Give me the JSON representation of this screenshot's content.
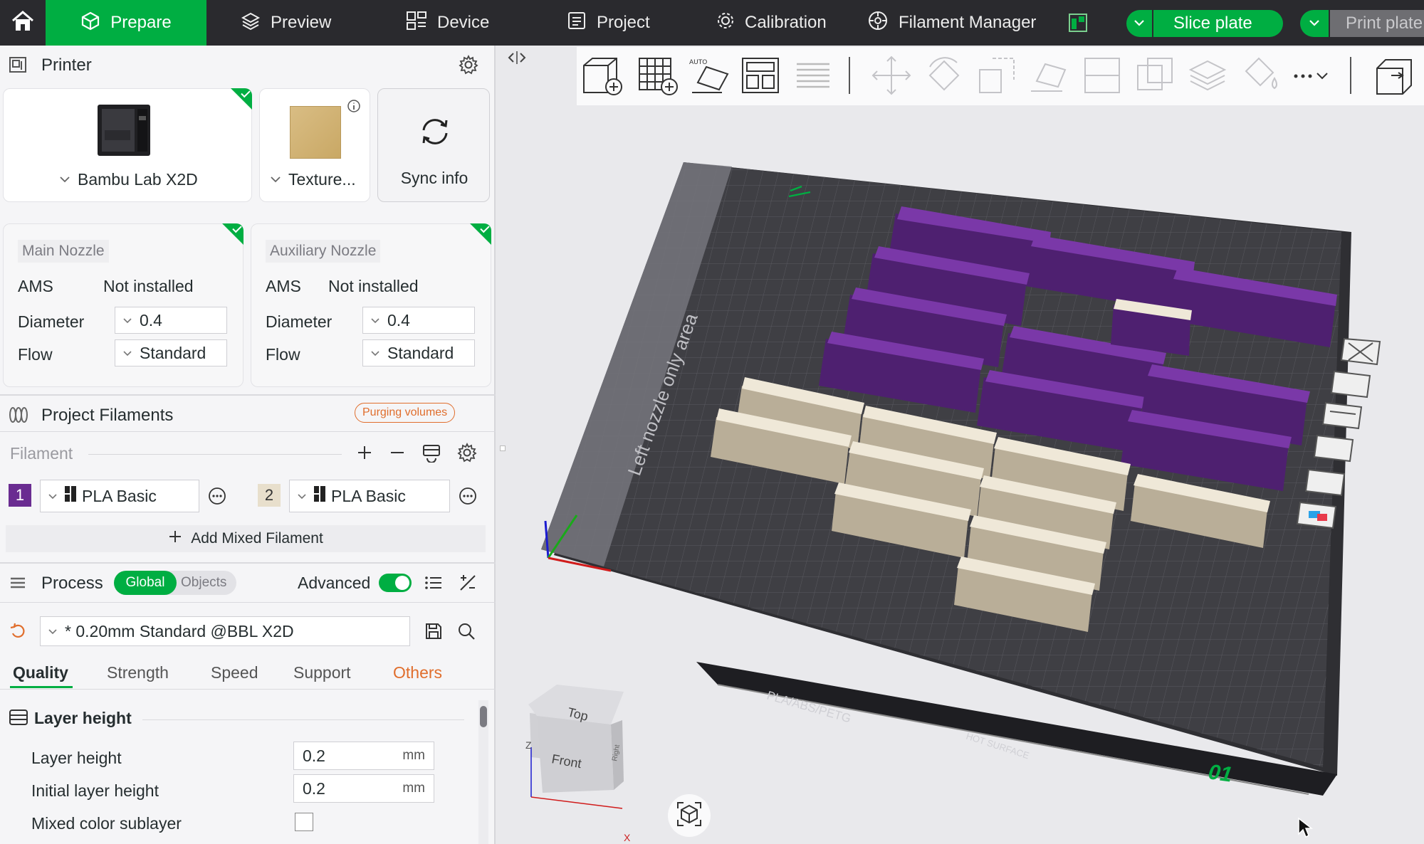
{
  "topbar": {
    "tabs": [
      {
        "label": "Prepare",
        "icon": "cube-icon"
      },
      {
        "label": "Preview",
        "icon": "layers-icon"
      },
      {
        "label": "Device",
        "icon": "device-icon"
      },
      {
        "label": "Project",
        "icon": "project-icon"
      },
      {
        "label": "Calibration",
        "icon": "calibration-icon"
      },
      {
        "label": "Filament Manager",
        "icon": "filament-manager-icon"
      }
    ],
    "slice_label": "Slice plate",
    "print_label": "Print plate"
  },
  "printer": {
    "title": "Printer",
    "model": "Bambu Lab X2D",
    "plate": "Texture...",
    "sync_label": "Sync info"
  },
  "main_nozzle": {
    "title": "Main Nozzle",
    "ams_label": "AMS",
    "ams_value": "Not installed",
    "diameter_label": "Diameter",
    "diameter_value": "0.4",
    "flow_label": "Flow",
    "flow_value": "Standard"
  },
  "aux_nozzle": {
    "title": "Auxiliary Nozzle",
    "ams_label": "AMS",
    "ams_value": "Not installed",
    "diameter_label": "Diameter",
    "diameter_value": "0.4",
    "flow_label": "Flow",
    "flow_value": "Standard"
  },
  "filaments": {
    "title": "Project Filaments",
    "purge_label": "Purging volumes",
    "filament_label": "Filament",
    "items": [
      {
        "index": "1",
        "name": "PLA Basic",
        "color": "#6a2c91"
      },
      {
        "index": "2",
        "name": "PLA Basic",
        "color": "#e8dfcc"
      }
    ],
    "add_mixed_label": "Add Mixed Filament"
  },
  "process": {
    "title": "Process",
    "toggle_global": "Global",
    "toggle_objects": "Objects",
    "advanced_label": "Advanced",
    "advanced_on": true,
    "preset": "* 0.20mm Standard @BBL X2D",
    "tabs": [
      "Quality",
      "Strength",
      "Speed",
      "Support",
      "Others"
    ],
    "active_tab": "Quality",
    "group_title": "Layer height",
    "fields": [
      {
        "label": "Layer height",
        "value": "0.2",
        "unit": "mm"
      },
      {
        "label": "Initial layer height",
        "value": "0.2",
        "unit": "mm"
      }
    ],
    "mixed_color_label": "Mixed color sublayer"
  },
  "viewport": {
    "left_area_label": "Left nozzle only area",
    "plate_text": "PLA/ABS/PETG",
    "hot_surface": "HOT SURFACE",
    "plate_number": "01",
    "cube_top": "Top",
    "cube_front": "Front",
    "cube_right": "Right",
    "axis_z": "Z",
    "axis_x": "X"
  },
  "colors": {
    "brand_green": "#00ae42",
    "purple_filament": "#6a2c91",
    "ivory_filament": "#e8dfcc",
    "orange_accent": "#e06e2d"
  }
}
